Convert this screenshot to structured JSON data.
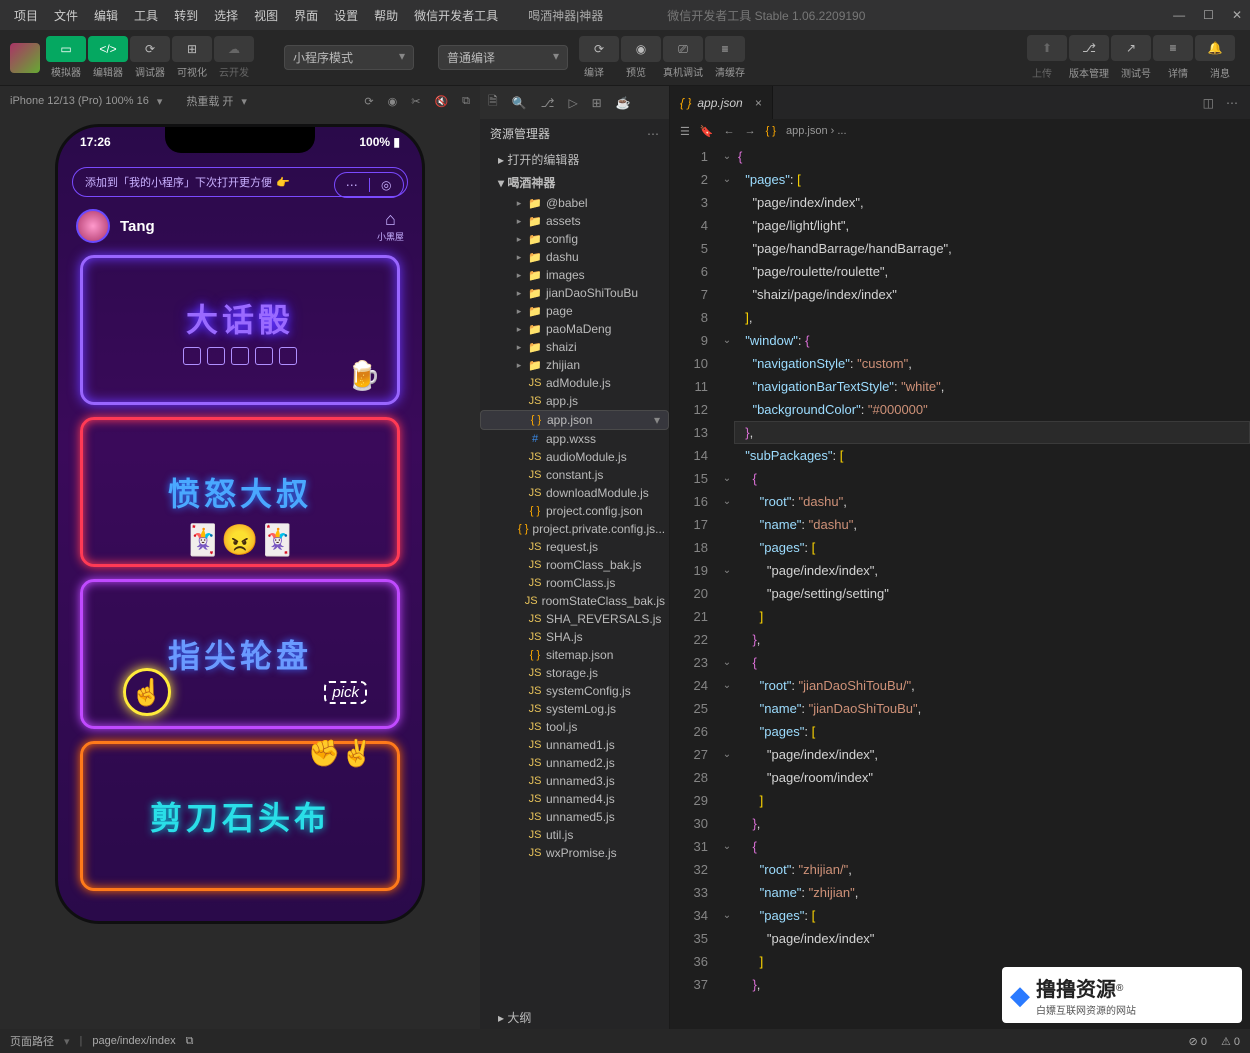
{
  "menu": [
    "项目",
    "文件",
    "编辑",
    "工具",
    "转到",
    "选择",
    "视图",
    "界面",
    "设置",
    "帮助",
    "微信开发者工具"
  ],
  "header": {
    "project": "喝酒神器|神器",
    "app_title": "微信开发者工具 Stable 1.06.2209190"
  },
  "toolbar": {
    "groups": {
      "sim": {
        "label": "模拟器"
      },
      "editor": {
        "label": "编辑器"
      },
      "debug": {
        "label": "调试器"
      },
      "visual": {
        "label": "可视化"
      },
      "cloud": {
        "label": "云开发"
      },
      "compile": {
        "label": "编译"
      },
      "preview": {
        "label": "预览"
      },
      "realdbg": {
        "label": "真机调试"
      },
      "clear": {
        "label": "清缓存"
      },
      "upload": {
        "label": "上传"
      },
      "version": {
        "label": "版本管理"
      },
      "testnum": {
        "label": "测试号"
      },
      "detail": {
        "label": "详情"
      },
      "msg": {
        "label": "消息"
      }
    },
    "mode_select": "小程序模式",
    "compile_select": "普通编译"
  },
  "sim": {
    "device": "iPhone 12/13 (Pro) 100% 16",
    "hot_reload": "热重载 开",
    "status_time": "17:26",
    "status_batt": "100%",
    "tip": "添加到「我的小程序」下次打开更方便",
    "tip_emoji": "👉",
    "user": "Tang",
    "minihome": "小黑屋",
    "cards": {
      "c1": "大话骰",
      "c2": "愤怒大叔",
      "c3": "指尖轮盘",
      "c3_pick": "pick",
      "c4": "剪刀石头布"
    }
  },
  "explorer": {
    "title": "资源管理器",
    "open_editors": "打开的编辑器",
    "project": "喝酒神器",
    "outline": "大纲",
    "tree": [
      {
        "n": "@babel",
        "t": "folder",
        "d": 2,
        "exp": false
      },
      {
        "n": "assets",
        "t": "folder",
        "d": 2,
        "exp": false
      },
      {
        "n": "config",
        "t": "folder",
        "d": 2,
        "exp": false
      },
      {
        "n": "dashu",
        "t": "folder",
        "d": 2,
        "exp": false
      },
      {
        "n": "images",
        "t": "folder",
        "d": 2,
        "exp": false
      },
      {
        "n": "jianDaoShiTouBu",
        "t": "folder",
        "d": 2,
        "exp": false
      },
      {
        "n": "page",
        "t": "folder",
        "d": 2,
        "exp": false
      },
      {
        "n": "paoMaDeng",
        "t": "folder",
        "d": 2,
        "exp": false
      },
      {
        "n": "shaizi",
        "t": "folder",
        "d": 2,
        "exp": false
      },
      {
        "n": "zhijian",
        "t": "folder",
        "d": 2,
        "exp": false
      },
      {
        "n": "adModule.js",
        "t": "js",
        "d": 2
      },
      {
        "n": "app.js",
        "t": "js",
        "d": 2
      },
      {
        "n": "app.json",
        "t": "json",
        "d": 2,
        "sel": true
      },
      {
        "n": "app.wxss",
        "t": "wxss",
        "d": 2
      },
      {
        "n": "audioModule.js",
        "t": "js",
        "d": 2
      },
      {
        "n": "constant.js",
        "t": "js",
        "d": 2
      },
      {
        "n": "downloadModule.js",
        "t": "js",
        "d": 2
      },
      {
        "n": "project.config.json",
        "t": "json",
        "d": 2
      },
      {
        "n": "project.private.config.js...",
        "t": "json",
        "d": 2
      },
      {
        "n": "request.js",
        "t": "js",
        "d": 2
      },
      {
        "n": "roomClass_bak.js",
        "t": "js",
        "d": 2
      },
      {
        "n": "roomClass.js",
        "t": "js",
        "d": 2
      },
      {
        "n": "roomStateClass_bak.js",
        "t": "js",
        "d": 2
      },
      {
        "n": "SHA_REVERSALS.js",
        "t": "js",
        "d": 2
      },
      {
        "n": "SHA.js",
        "t": "js",
        "d": 2
      },
      {
        "n": "sitemap.json",
        "t": "json",
        "d": 2
      },
      {
        "n": "storage.js",
        "t": "js",
        "d": 2
      },
      {
        "n": "systemConfig.js",
        "t": "js",
        "d": 2
      },
      {
        "n": "systemLog.js",
        "t": "js",
        "d": 2
      },
      {
        "n": "tool.js",
        "t": "js",
        "d": 2
      },
      {
        "n": "unnamed1.js",
        "t": "js",
        "d": 2
      },
      {
        "n": "unnamed2.js",
        "t": "js",
        "d": 2
      },
      {
        "n": "unnamed3.js",
        "t": "js",
        "d": 2
      },
      {
        "n": "unnamed4.js",
        "t": "js",
        "d": 2
      },
      {
        "n": "unnamed5.js",
        "t": "js",
        "d": 2
      },
      {
        "n": "util.js",
        "t": "js",
        "d": 2
      },
      {
        "n": "wxPromise.js",
        "t": "js",
        "d": 2
      }
    ]
  },
  "editor": {
    "tab_file": "app.json",
    "breadcrumb": "app.json › ...",
    "gutter_start": 1,
    "gutter_end": 37,
    "highlight_line": 13,
    "fold_lines": [
      1,
      2,
      9,
      15,
      16,
      19,
      23,
      24,
      27,
      31,
      34
    ],
    "code": [
      "{",
      "  \"pages\": [",
      "    \"page/index/index\",",
      "    \"page/light/light\",",
      "    \"page/handBarrage/handBarrage\",",
      "    \"page/roulette/roulette\",",
      "    \"shaizi/page/index/index\"",
      "  ],",
      "  \"window\": {",
      "    \"navigationStyle\": \"custom\",",
      "    \"navigationBarTextStyle\": \"white\",",
      "    \"backgroundColor\": \"#000000\"",
      "  },",
      "  \"subPackages\": [",
      "    {",
      "      \"root\": \"dashu\",",
      "      \"name\": \"dashu\",",
      "      \"pages\": [",
      "        \"page/index/index\",",
      "        \"page/setting/setting\"",
      "      ]",
      "    },",
      "    {",
      "      \"root\": \"jianDaoShiTouBu/\",",
      "      \"name\": \"jianDaoShiTouBu\",",
      "      \"pages\": [",
      "        \"page/index/index\",",
      "        \"page/room/index\"",
      "      ]",
      "    },",
      "    {",
      "      \"root\": \"zhijian/\",",
      "      \"name\": \"zhijian\",",
      "      \"pages\": [",
      "        \"page/index/index\"",
      "      ]",
      "    },"
    ]
  },
  "status": {
    "route_label": "页面路径",
    "route": "page/index/index",
    "errors": "0",
    "warnings": "0"
  },
  "watermark": {
    "brand": "撸撸资源",
    "reg": "®",
    "slogan": "白嫖互联网资源的网站"
  }
}
